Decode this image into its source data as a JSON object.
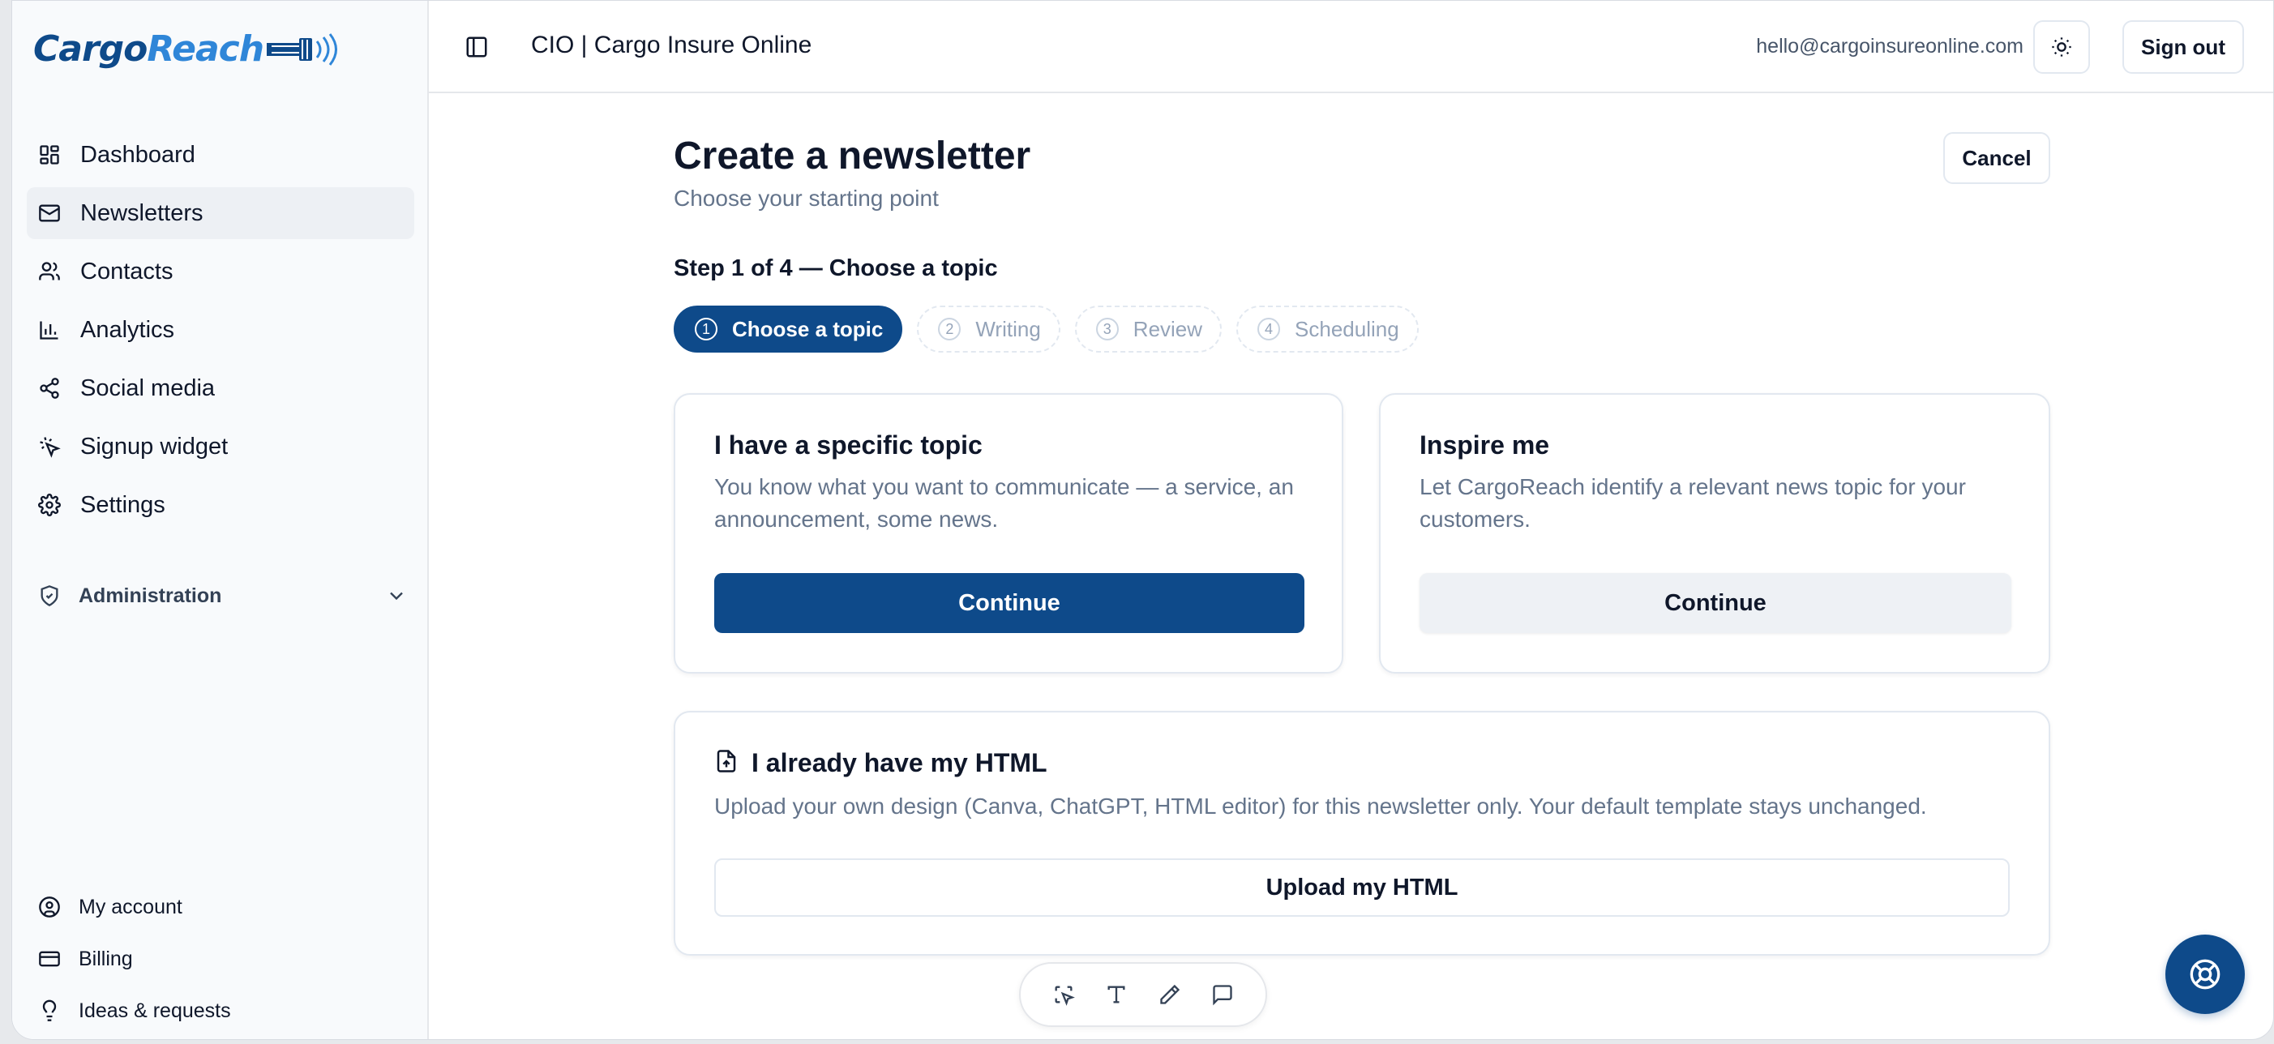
{
  "brand": {
    "logo_part1": "Cargo",
    "logo_part2": "Reach",
    "primary_color": "#0e4a8a",
    "accent_color": "#2f86d8"
  },
  "sidebar": {
    "items": [
      {
        "label": "Dashboard",
        "icon": "dashboard-icon"
      },
      {
        "label": "Newsletters",
        "icon": "mail-icon",
        "active": true
      },
      {
        "label": "Contacts",
        "icon": "users-icon"
      },
      {
        "label": "Analytics",
        "icon": "bar-chart-icon"
      },
      {
        "label": "Social media",
        "icon": "share-icon"
      },
      {
        "label": "Signup widget",
        "icon": "pointer-click-icon"
      },
      {
        "label": "Settings",
        "icon": "gear-icon"
      }
    ],
    "admin": {
      "label": "Administration",
      "icon": "shield-check-icon"
    },
    "bottom": [
      {
        "label": "My account",
        "icon": "user-circle-icon"
      },
      {
        "label": "Billing",
        "icon": "credit-card-icon"
      },
      {
        "label": "Ideas & requests",
        "icon": "lightbulb-icon"
      }
    ]
  },
  "topbar": {
    "title": "CIO | Cargo Insure Online",
    "email": "hello@cargoinsureonline.com",
    "sign_out": "Sign out"
  },
  "main": {
    "title": "Create a newsletter",
    "subtitle": "Choose your starting point",
    "cancel": "Cancel",
    "step_label": "Step 1 of 4 — Choose a topic",
    "steps": [
      {
        "num": "1",
        "label": "Choose a topic",
        "active": true
      },
      {
        "num": "2",
        "label": "Writing"
      },
      {
        "num": "3",
        "label": "Review"
      },
      {
        "num": "4",
        "label": "Scheduling"
      }
    ],
    "cards": {
      "specific": {
        "title": "I have a specific topic",
        "description": "You know what you want to communicate — a service, an announcement, some news.",
        "button": "Continue"
      },
      "inspire": {
        "title": "Inspire me",
        "description": "Let CargoReach identify a relevant news topic for your customers.",
        "button": "Continue"
      },
      "html": {
        "title": "I already have my HTML",
        "description": "Upload your own design (Canva, ChatGPT, HTML editor) for this newsletter only. Your default template stays unchanged.",
        "button": "Upload my HTML",
        "icon": "file-upload-icon"
      }
    }
  },
  "toolbar": {
    "icons": [
      "select-icon",
      "text-icon",
      "pen-icon",
      "comment-icon"
    ]
  },
  "help": {
    "icon": "lifebuoy-icon"
  }
}
